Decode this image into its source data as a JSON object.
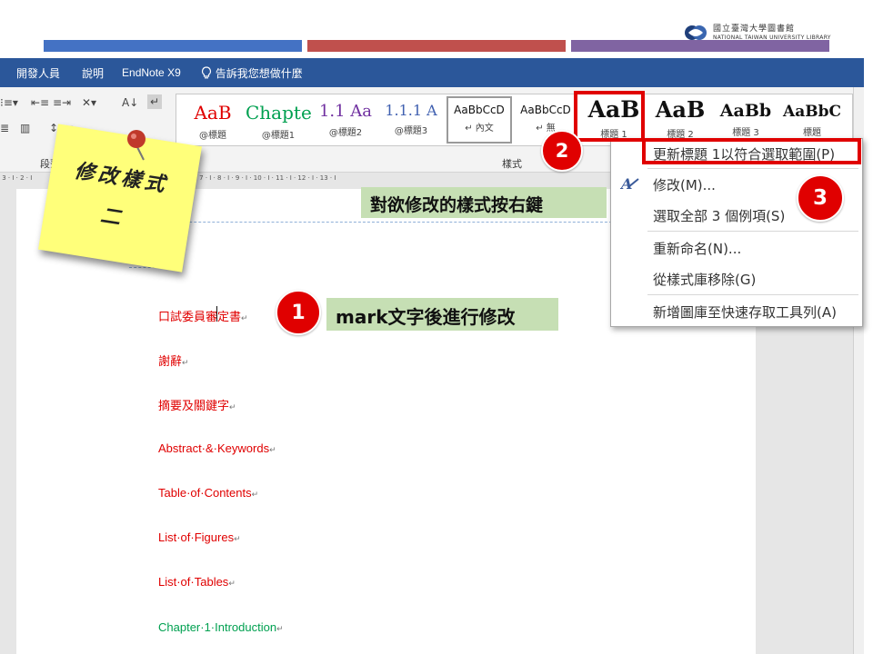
{
  "colors": {
    "bar_blue": "#4472c4",
    "bar_red": "#c0504d",
    "bar_purple": "#8064a2",
    "word_blue": "#2b579a",
    "highlight_red": "#e00000",
    "callout_green": "#c6dfb4",
    "sticky_yellow": "#ffff7a",
    "doc_red": "#e00000",
    "doc_green": "#00a050"
  },
  "logo": {
    "name_zh": "國立臺灣大學圖書館",
    "name_en": "NATIONAL TAIWAN UNIVERSITY LIBRARY"
  },
  "tabs": [
    {
      "label": "開發人員"
    },
    {
      "label": "說明"
    },
    {
      "label": "EndNote X9"
    }
  ],
  "tell_me": {
    "icon": "lightbulb-icon",
    "label": "告訴我您想做什麼"
  },
  "ribbon": {
    "paragraph_group_label": "段落",
    "styles_group_label": "樣式"
  },
  "styles": [
    {
      "sample": "AaB",
      "name": "@標題"
    },
    {
      "sample": "Chapte",
      "name": "@標題1"
    },
    {
      "sample": "1.1  Aa",
      "name": "@標題2"
    },
    {
      "sample": "1.1.1  A",
      "name": "@標題3"
    },
    {
      "sample": "AaBbCcD",
      "name": "↵ 內文"
    },
    {
      "sample": "AaBbCcD",
      "name": "↵ 無"
    },
    {
      "sample": "AaB",
      "name": "標題 1"
    },
    {
      "sample": "AaB",
      "name": "標題 2"
    },
    {
      "sample": "AaBb",
      "name": "標題 3"
    },
    {
      "sample": "AaBbC",
      "name": "標題"
    }
  ],
  "context_menu": {
    "items": [
      {
        "label": "更新標題 1以符合選取範圍(P)"
      },
      {
        "label": "修改(M)..."
      },
      {
        "label": "選取全部 3 個例項(S)"
      },
      {
        "label": "重新命名(N)..."
      },
      {
        "label": "從樣式庫移除(G)"
      },
      {
        "label": "新增圖庫至快速存取工具列(A)"
      }
    ]
  },
  "document": {
    "lines": [
      {
        "text": "口試委員審定書"
      },
      {
        "text": "謝辭"
      },
      {
        "text": "摘要及關鍵字"
      },
      {
        "text": "Abstract·&·Keywords"
      },
      {
        "text": "Table·of·Contents"
      },
      {
        "text": "List·of·Figures"
      },
      {
        "text": "List·of·Tables"
      },
      {
        "text": "Chapter·1·Introduction"
      }
    ],
    "para_mark": "↵"
  },
  "annotations": {
    "sticky_title": "修改樣式",
    "sticky_sub": "二",
    "callout_right_click": "對欲修改的樣式按右鍵",
    "callout_mark": "mark文字後進行修改",
    "step1": "1",
    "step2": "2",
    "step3": "3"
  }
}
